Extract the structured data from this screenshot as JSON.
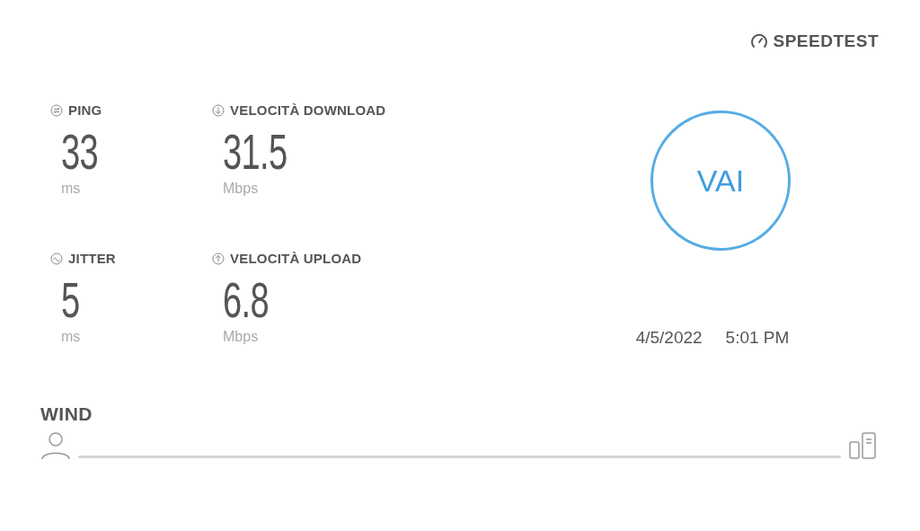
{
  "brand": {
    "name": "SPEEDTEST"
  },
  "metrics": [
    {
      "kind": "ping",
      "label": "PING",
      "value": "33",
      "unit": "ms"
    },
    {
      "kind": "download",
      "label": "VELOCITÀ DOWNLOAD",
      "value": "31.5",
      "unit": "Mbps"
    },
    {
      "kind": "jitter",
      "label": "JITTER",
      "value": "5",
      "unit": "ms"
    },
    {
      "kind": "upload",
      "label": "VELOCITÀ UPLOAD",
      "value": "6.8",
      "unit": "Mbps"
    }
  ],
  "start_button": {
    "label": "VAI"
  },
  "result_time": {
    "date": "4/5/2022",
    "time": "5:01 PM"
  },
  "provider": {
    "name": "WIND"
  }
}
